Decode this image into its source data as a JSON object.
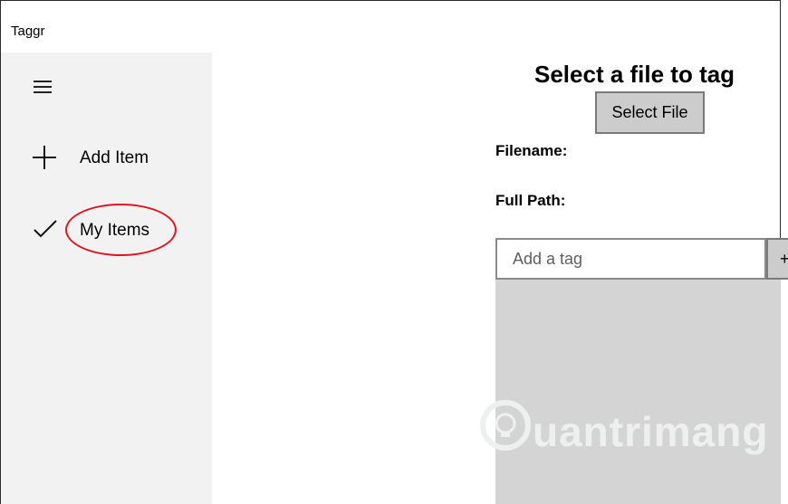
{
  "app": {
    "title": "Taggr"
  },
  "sidebar": {
    "menu_icon": "hamburger-icon",
    "items": [
      {
        "label": "Add Item",
        "icon": "plus-icon"
      },
      {
        "label": "My Items",
        "icon": "check-icon",
        "highlighted": true
      }
    ]
  },
  "main": {
    "heading": "Select a file to tag",
    "select_button_label": "Select File",
    "filename_label": "Filename:",
    "full_path_label": "Full Path:",
    "tag_input_placeholder": "Add a tag",
    "add_tag_button_label": "+"
  },
  "watermark": {
    "text": "uantrimang",
    "icon": "lightbulb-icon"
  },
  "colors": {
    "sidebar_bg": "#f2f2f2",
    "button_bg": "#cccccc",
    "tag_area_bg": "#d4d4d4",
    "highlight": "#e0141e"
  }
}
